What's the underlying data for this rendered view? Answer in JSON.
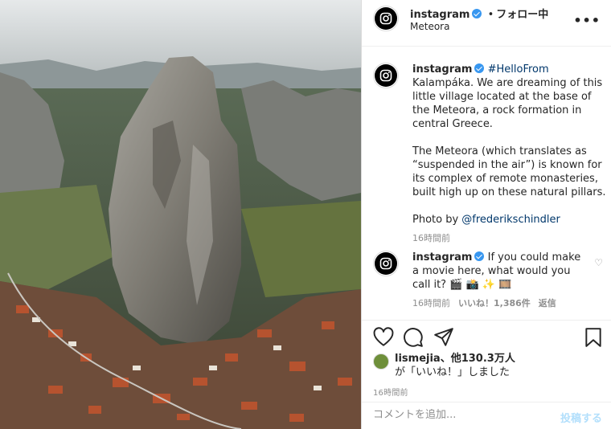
{
  "photo": {
    "alt": "Meteora aerial view"
  },
  "header": {
    "username": "instagram",
    "separator": "•",
    "follow_label": "フォロー中",
    "location": "Meteora",
    "more_icon": "more-horizontal-icon"
  },
  "caption": {
    "username": "instagram",
    "hashtag": "#HelloFrom",
    "text1": " Kalampáka. We are dreaming of this little village located at the base of the Meteora, a rock formation in central Greece.",
    "text2": "The Meteora (which translates as “suspended in the air”) is known for its complex of remote monasteries, built high up on these natural pillars.",
    "photo_by": "Photo by ",
    "mention": "@frederikschindler",
    "time": "16時間前"
  },
  "comment": {
    "username": "instagram",
    "text": " If you could make a movie here, what would you call it? 🎬 📸 ✨ 🎞️",
    "time": "16時間前",
    "likes": "いいね！1,386件",
    "reply": "返信"
  },
  "actions": {
    "like_icon": "heart-icon",
    "comment_icon": "comment-icon",
    "share_icon": "share-icon",
    "save_icon": "bookmark-icon"
  },
  "likes": {
    "user": "lismejia",
    "others": "、他130.3万人",
    "suffix": "が「いいね！」しました"
  },
  "post_time": "16時間前",
  "comment_input": {
    "placeholder": "コメントを追加...",
    "post_label": "投稿する"
  },
  "colors": {
    "verified": "#3897f0",
    "link": "#00376b",
    "post_button": "#b2dffc",
    "muted": "#8e8e8e"
  }
}
